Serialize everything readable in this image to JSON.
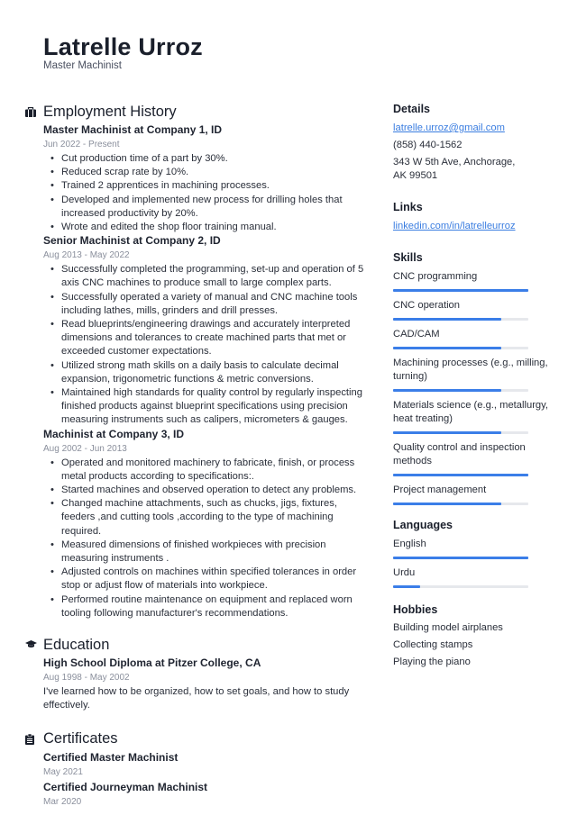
{
  "header": {
    "name": "Latrelle Urroz",
    "title": "Master Machinist"
  },
  "employment": {
    "heading": "Employment History",
    "icon": "briefcase-icon",
    "jobs": [
      {
        "title": "Master Machinist at Company 1, ID",
        "dates": "Jun 2022 - Present",
        "bullets": [
          "Cut production time of a part by 30%.",
          "Reduced scrap rate by 10%.",
          "Trained 2 apprentices in machining processes.",
          "Developed and implemented new process for drilling holes that increased productivity by 20%.",
          "Wrote and edited the shop floor training manual."
        ]
      },
      {
        "title": "Senior Machinist at Company 2, ID",
        "dates": "Aug 2013 - May 2022",
        "bullets": [
          "Successfully completed the programming, set-up and operation of 5 axis CNC machines to produce small to large complex parts.",
          "Successfully operated a variety of manual and CNC machine tools including lathes, mills, grinders and drill presses.",
          "Read blueprints/engineering drawings and accurately interpreted dimensions and tolerances to create machined parts that met or exceeded customer expectations.",
          "Utilized strong math skills on a daily basis to calculate decimal expansion, trigonometric functions & metric conversions.",
          "Maintained high standards for quality control by regularly inspecting finished products against blueprint specifications using precision measuring instruments such as calipers, micrometers & gauges."
        ]
      },
      {
        "title": "Machinist at Company 3, ID",
        "dates": "Aug 2002 - Jun 2013",
        "bullets": [
          "Operated and monitored machinery to fabricate, finish, or process metal products according to specifications:.",
          "Started machines and observed operation to detect any problems.",
          "Changed machine attachments, such as chucks, jigs, fixtures, feeders ,and cutting tools ,according to the type of machining required.",
          "Measured dimensions of finished workpieces with precision measuring instruments .",
          "Adjusted controls on machines within specified tolerances in order stop or adjust flow of materials into workpiece.",
          "Performed routine maintenance on equipment and replaced worn tooling following manufacturer's recommendations."
        ]
      }
    ]
  },
  "education": {
    "heading": "Education",
    "icon": "graduation-cap-icon",
    "items": [
      {
        "title": "High School Diploma at Pitzer College, CA",
        "dates": "Aug 1998 - May 2002",
        "description": "I've learned how to be organized, how to set goals, and how to study effectively."
      }
    ]
  },
  "certificates": {
    "heading": "Certificates",
    "icon": "clipboard-icon",
    "items": [
      {
        "title": "Certified Master Machinist",
        "date": "May 2021"
      },
      {
        "title": "Certified Journeyman Machinist",
        "date": "Mar 2020"
      }
    ]
  },
  "details": {
    "heading": "Details",
    "email": "latrelle.urroz@gmail.com",
    "phone": "(858) 440-1562",
    "address": "343 W 5th Ave, Anchorage, AK 99501"
  },
  "links": {
    "heading": "Links",
    "items": [
      "linkedin.com/in/latrelleurroz"
    ]
  },
  "skills": {
    "heading": "Skills",
    "items": [
      {
        "label": "CNC programming",
        "level": 1.0
      },
      {
        "label": "CNC operation",
        "level": 0.8
      },
      {
        "label": "CAD/CAM",
        "level": 0.8
      },
      {
        "label": "Machining processes (e.g., milling, turning)",
        "level": 0.8
      },
      {
        "label": "Materials science (e.g., metallurgy, heat treating)",
        "level": 0.8
      },
      {
        "label": "Quality control and inspection methods",
        "level": 1.0
      },
      {
        "label": "Project management",
        "level": 0.8
      }
    ]
  },
  "languages": {
    "heading": "Languages",
    "items": [
      {
        "label": "English",
        "level": 1.0
      },
      {
        "label": "Urdu",
        "level": 0.2
      }
    ]
  },
  "hobbies": {
    "heading": "Hobbies",
    "items": [
      "Building model airplanes",
      "Collecting stamps",
      "Playing the piano"
    ]
  },
  "colors": {
    "accent": "#3b7ee8",
    "link": "#3a7de0",
    "bar_track": "#e6e8ec",
    "text": "#1f2430",
    "muted": "#8a8f9c"
  }
}
